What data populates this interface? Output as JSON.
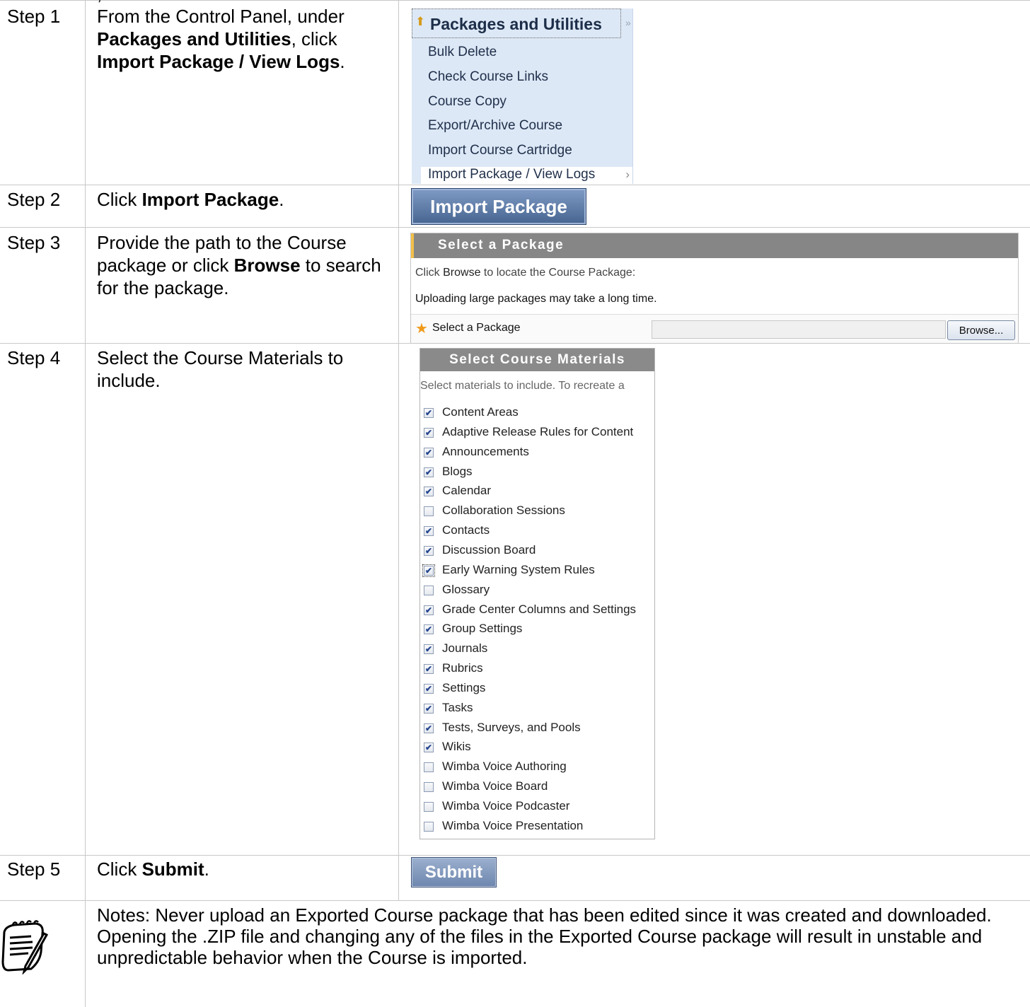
{
  "top_cut_text": ", . . . . . . . . . . . . . . . . . . .",
  "steps": [
    {
      "label": "Step 1",
      "pre": "From the Control Panel, under ",
      "b1": "Packages and Utilities",
      "mid": ", click ",
      "b2": "Import Package / View Logs",
      "post": "."
    },
    {
      "label": "Step 2",
      "pre": "Click ",
      "b1": "Import Package",
      "post": "."
    },
    {
      "label": "Step 3",
      "pre": "Provide the path to the Course package or click ",
      "b1": "Browse",
      "post": " to search for the package."
    },
    {
      "label": "Step 4",
      "text": "Select the Course Materials to include."
    },
    {
      "label": "Step 5",
      "pre": "Click ",
      "b1": "Submit",
      "post": "."
    }
  ],
  "packages_menu": {
    "title": "Packages and Utilities",
    "items": [
      "Bulk Delete",
      "Check Course Links",
      "Course Copy",
      "Export/Archive Course",
      "Import Course Cartridge",
      "Import Package / View Logs"
    ]
  },
  "import_button": "Import Package",
  "select_package": {
    "header": "Select a Package",
    "line1_pre": "Click ",
    "line1_b": "Browse",
    "line1_post": " to locate the Course Package:",
    "line2": "Uploading large packages may take a long time.",
    "field_label": "Select a Package",
    "browse": "Browse..."
  },
  "course_materials": {
    "header": "Select Course Materials",
    "intro": "Select materials to include. To recreate a",
    "items": [
      {
        "label": "Content Areas",
        "checked": true
      },
      {
        "label": "Adaptive Release Rules for Content",
        "checked": true
      },
      {
        "label": "Announcements",
        "checked": true
      },
      {
        "label": "Blogs",
        "checked": true
      },
      {
        "label": "Calendar",
        "checked": true
      },
      {
        "label": "Collaboration Sessions",
        "checked": false
      },
      {
        "label": "Contacts",
        "checked": true
      },
      {
        "label": "Discussion Board",
        "checked": true
      },
      {
        "label": "Early Warning System Rules",
        "checked": true
      },
      {
        "label": "Glossary",
        "checked": false
      },
      {
        "label": "Grade Center Columns and Settings",
        "checked": true
      },
      {
        "label": "Group Settings",
        "checked": true
      },
      {
        "label": "Journals",
        "checked": true
      },
      {
        "label": "Rubrics",
        "checked": true
      },
      {
        "label": "Settings",
        "checked": true
      },
      {
        "label": "Tasks",
        "checked": true
      },
      {
        "label": "Tests, Surveys, and Pools",
        "checked": true
      },
      {
        "label": "Wikis",
        "checked": true
      },
      {
        "label": "Wimba Voice Authoring",
        "checked": false
      },
      {
        "label": "Wimba Voice Board",
        "checked": false
      },
      {
        "label": "Wimba Voice Podcaster",
        "checked": false
      },
      {
        "label": "Wimba Voice Presentation",
        "checked": false
      }
    ]
  },
  "submit_button": "Submit",
  "notes": "Notes: Never upload an Exported Course package that has been edited since it was created and downloaded. Opening the .ZIP file and changing any of the files in the Exported Course package will result in unstable and unpredictable behavior when the Course is imported."
}
